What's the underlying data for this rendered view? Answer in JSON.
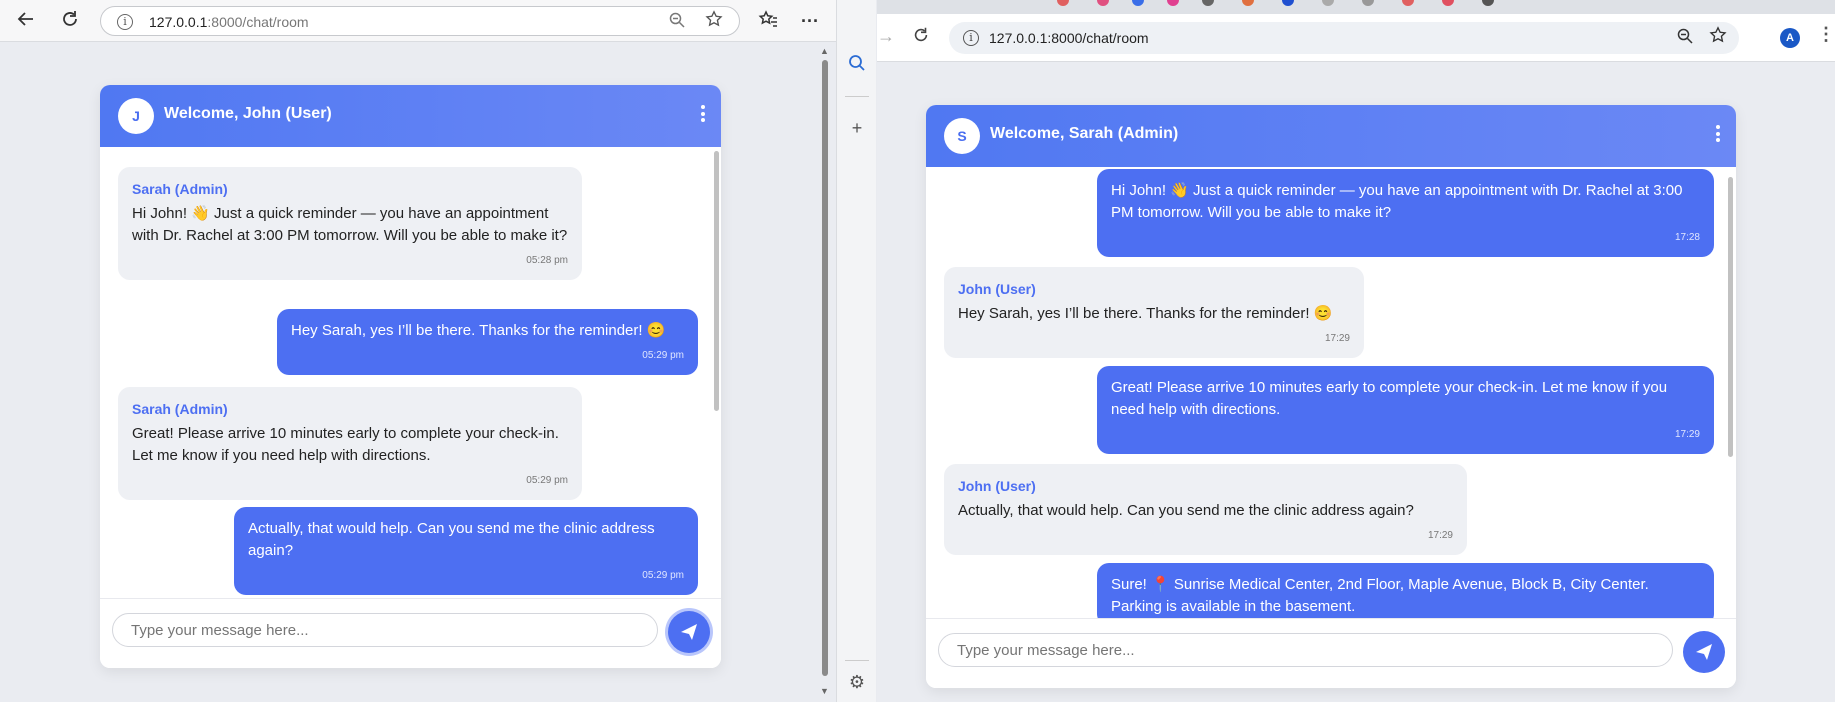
{
  "left_window": {
    "browser": "edge",
    "url_host": "127.0.0.1",
    "url_rest": ":8000/chat/room",
    "chat": {
      "avatar_letter": "J",
      "header_title": "Welcome, John (User)",
      "input_placeholder": "Type your message here...",
      "messages": [
        {
          "direction": "in",
          "sender": "Sarah (Admin)",
          "text": "Hi John! 👋 Just a quick reminder — you have an appointment with Dr. Rachel at 3:00 PM tomorrow. Will you be able to make it?",
          "time": "05:28 pm"
        },
        {
          "direction": "out",
          "sender": "",
          "text": "Hey Sarah, yes I’ll be there. Thanks for the reminder! 😊",
          "time": "05:29 pm"
        },
        {
          "direction": "in",
          "sender": "Sarah (Admin)",
          "text": "Great! Please arrive 10 minutes early to complete your check-in. Let me know if you need help with directions.",
          "time": "05:29 pm"
        },
        {
          "direction": "out",
          "sender": "",
          "text": "Actually, that would help. Can you send me the clinic address again?",
          "time": "05:29 pm"
        }
      ]
    }
  },
  "right_window": {
    "browser": "chrome",
    "url": "127.0.0.1:8000/chat/room",
    "profile_letter": "A",
    "chat": {
      "avatar_letter": "S",
      "header_title": "Welcome, Sarah (Admin)",
      "input_placeholder": "Type your message here...",
      "messages": [
        {
          "direction": "out",
          "sender": "",
          "text": "Hi John! 👋 Just a quick reminder — you have an appointment with Dr. Rachel at 3:00 PM tomorrow. Will you be able to make it?",
          "time": "17:28"
        },
        {
          "direction": "in",
          "sender": "John (User)",
          "text": "Hey Sarah, yes I’ll be there. Thanks for the reminder! 😊",
          "time": "17:29"
        },
        {
          "direction": "out",
          "sender": "",
          "text": "Great! Please arrive 10 minutes early to complete your check-in. Let me know if you need help with directions.",
          "time": "17:29"
        },
        {
          "direction": "in",
          "sender": "John (User)",
          "text": "Actually, that would help. Can you send me the clinic address again?",
          "time": "17:29"
        },
        {
          "direction": "out",
          "sender": "",
          "text": "Sure! 📍 Sunrise Medical Center, 2nd Floor, Maple Avenue, Block B, City Center. Parking is available in the basement.",
          "time": ""
        }
      ]
    }
  },
  "colors": {
    "accent": "#4d6ff2",
    "incoming_bubble": "#eef0f4"
  }
}
